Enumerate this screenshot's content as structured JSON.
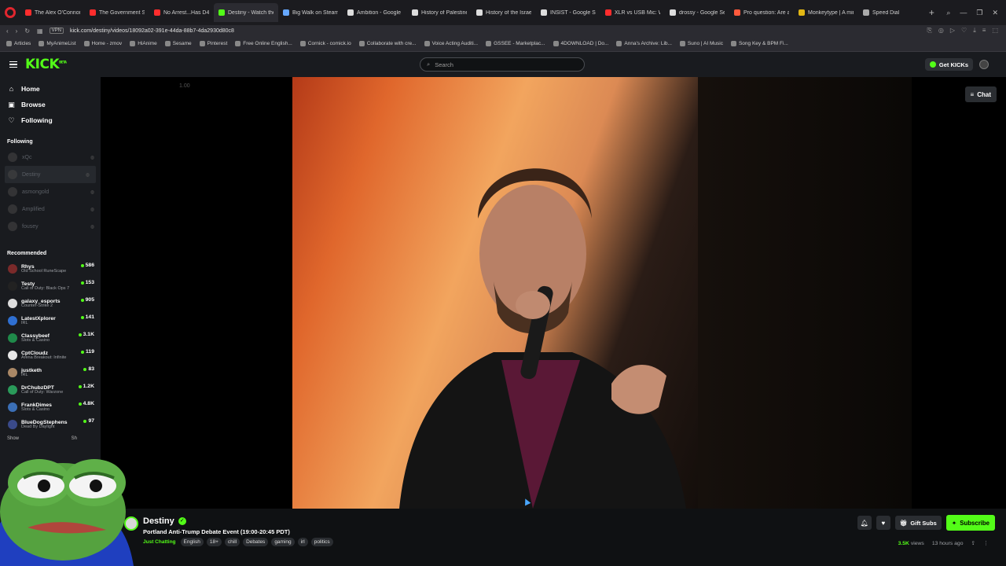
{
  "browser": {
    "tabs": [
      {
        "title": "The Alex O'Connor Podc",
        "color": "#ff2d2d"
      },
      {
        "title": "The Government Shutdo",
        "color": "#ff2d2d"
      },
      {
        "title": "No Arrest...Has D4vd Be",
        "color": "#ff2d2d"
      },
      {
        "title": "Destiny - Watch the V",
        "color": "#53fc18",
        "active": true
      },
      {
        "title": "Big Walk on Steam",
        "color": "#66a8ff"
      },
      {
        "title": "Ambition - Google Sear",
        "color": "#dddddd"
      },
      {
        "title": "History of Palestine - Wik",
        "color": "#dddddd"
      },
      {
        "title": "History of the Israeli-Pal",
        "color": "#dddddd"
      },
      {
        "title": "INSIST - Google Search",
        "color": "#dddddd"
      },
      {
        "title": "XLR vs USB Mic: Which S",
        "color": "#ff2d2d"
      },
      {
        "title": "drossy - Google Search",
        "color": "#dddddd"
      },
      {
        "title": "Pro question: Are all mi",
        "color": "#ff5a3c"
      },
      {
        "title": "Monkeytype | A minimal",
        "color": "#e2b714"
      },
      {
        "title": "Speed Dial",
        "color": "#aaaaaa"
      }
    ],
    "vpn_label": "VPN",
    "url": "kick.com/destiny/videos/18092a02-391e-44da-88b7-4da2930d80c8",
    "bookmarks": [
      "Articles",
      "MyAnimeList",
      "Home - zmov",
      "HiAnime",
      "Sesame",
      "Pinterest",
      "Free Online English...",
      "Cornick - comick.io",
      "Collaborate with cre...",
      "Voice Acting Auditi...",
      "GSSEE - Marketplac...",
      "4DOWNLOAD | Do...",
      "Anna's Archive: Lib...",
      "Suno | AI Music",
      "Song Key & BPM Fi..."
    ]
  },
  "header": {
    "logo": "KICK",
    "logo_badge": "BETA",
    "search_placeholder": "Search",
    "get_kicks": "Get KICKs"
  },
  "sidebar": {
    "nav": [
      {
        "label": "Home",
        "icon": "home-icon"
      },
      {
        "label": "Browse",
        "icon": "browse-icon"
      },
      {
        "label": "Following",
        "icon": "heart-icon"
      }
    ],
    "following_title": "Following",
    "following": [
      "xQc",
      "Destiny",
      "asmongold",
      "Amplified",
      "fousey"
    ],
    "recommended_title": "Recommended",
    "recommended": [
      {
        "name": "Rhys",
        "game": "Old School RuneScape",
        "viewers": "586",
        "color": "#7a2a2a"
      },
      {
        "name": "Testy",
        "game": "Call of Duty: Black Ops 7",
        "viewers": "153",
        "color": "#222222"
      },
      {
        "name": "galaxy_esports",
        "game": "Counter-Strike 2",
        "viewers": "905",
        "color": "#dddddd"
      },
      {
        "name": "LatestXplorer",
        "game": "IRL",
        "viewers": "141",
        "color": "#2f6fd1"
      },
      {
        "name": "Classybeef",
        "game": "Slots & Casino",
        "viewers": "3.1K",
        "color": "#1f8a4a"
      },
      {
        "name": "CptCloudz",
        "game": "Arena Breakout: Infinite",
        "viewers": "119",
        "color": "#e7e7e7"
      },
      {
        "name": "justketh",
        "game": "IRL",
        "viewers": "83",
        "color": "#aa8866"
      },
      {
        "name": "DrChubzDPT",
        "game": "Call of Duty: Warzone",
        "viewers": "1.2K",
        "color": "#2a9a5a"
      },
      {
        "name": "FrankDimes",
        "game": "Slots & Casino",
        "viewers": "4.8K",
        "color": "#3b6fb6"
      },
      {
        "name": "BlueDogStephens",
        "game": "Dead By Daylight",
        "viewers": "97",
        "color": "#3a4a8a"
      }
    ],
    "show_more": "Show",
    "show_more_right": "Sh"
  },
  "player": {
    "zoom_label": "1.00",
    "chat_label": "Chat"
  },
  "channel": {
    "name": "Destiny",
    "title": "Portland Anti-Trump Debate Event (19:00-20:45 PDT)",
    "category": "Just Chatting",
    "tags": [
      "English",
      "18+",
      "chill",
      "Debates",
      "gaming",
      "irl",
      "politics"
    ],
    "gift_subs": "Gift Subs",
    "subscribe": "Subscribe",
    "views": "3.5K",
    "views_label": "views",
    "ago": "13 hours ago"
  },
  "colors": {
    "accent": "#53fc18",
    "background": "#0b0e0f",
    "panel": "#191b1f"
  }
}
